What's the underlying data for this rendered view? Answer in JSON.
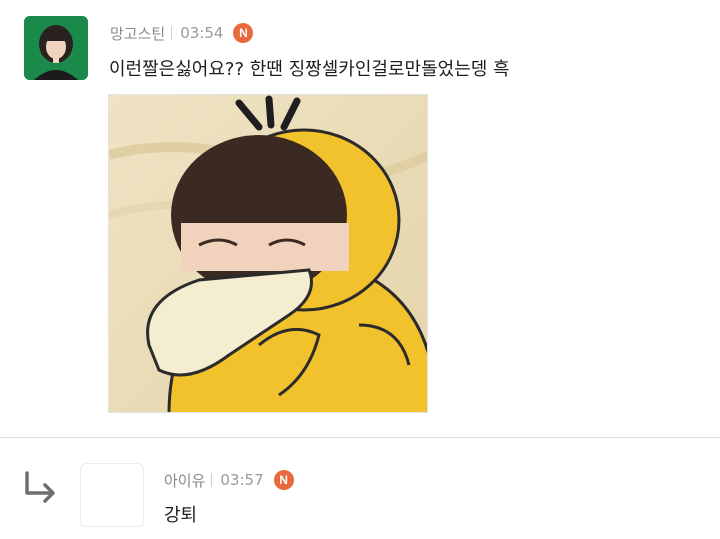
{
  "comments": [
    {
      "author": "망고스틴",
      "time": "03:54",
      "badge": "N",
      "text": "이런짤은싫어요?? 한땐 징짱셀카인걸로만돌었는뎅 흑"
    },
    {
      "author": "아이유",
      "time": "03:57",
      "badge": "N",
      "text": "강퇴"
    }
  ],
  "colors": {
    "badge": "#e8693c",
    "avatar_bg": "#1a8a4a",
    "psyduck_yellow": "#f2c22c"
  },
  "icons": {
    "new_badge": "new-badge-icon",
    "reply": "reply-arrow-icon"
  }
}
